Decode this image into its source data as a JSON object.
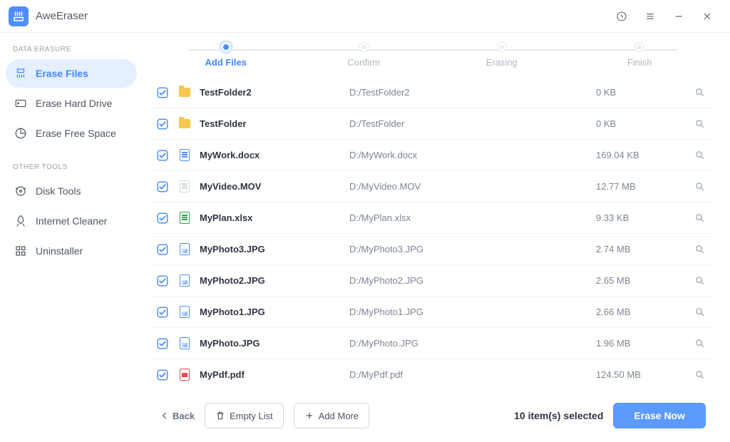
{
  "app": {
    "name": "AweEraser"
  },
  "sidebar": {
    "section1_label": "DATA ERASURE",
    "section2_label": "OTHER TOOLS",
    "items1": [
      {
        "label": "Erase Files",
        "active": true,
        "icon": "shredder"
      },
      {
        "label": "Erase Hard Drive",
        "active": false,
        "icon": "hdd"
      },
      {
        "label": "Erase Free Space",
        "active": false,
        "icon": "pie"
      }
    ],
    "items2": [
      {
        "label": "Disk Tools",
        "active": false,
        "icon": "disktool"
      },
      {
        "label": "Internet Cleaner",
        "active": false,
        "icon": "rocket"
      },
      {
        "label": "Uninstaller",
        "active": false,
        "icon": "apps"
      }
    ]
  },
  "steps": [
    {
      "label": "Add Files",
      "active": true
    },
    {
      "label": "Confirm",
      "active": false
    },
    {
      "label": "Erasing",
      "active": false
    },
    {
      "label": "Finish",
      "active": false
    }
  ],
  "files": [
    {
      "name": "TestFolder2",
      "path": "D:/TestFolder2",
      "size": "0 KB",
      "type": "folder"
    },
    {
      "name": "TestFolder",
      "path": "D:/TestFolder",
      "size": "0 KB",
      "type": "folder"
    },
    {
      "name": "MyWork.docx",
      "path": "D:/MyWork.docx",
      "size": "169.04 KB",
      "type": "doc"
    },
    {
      "name": "MyVideo.MOV",
      "path": "D:/MyVideo.MOV",
      "size": "12.77 MB",
      "type": "generic"
    },
    {
      "name": "MyPlan.xlsx",
      "path": "D:/MyPlan.xlsx",
      "size": "9.33 KB",
      "type": "xls"
    },
    {
      "name": "MyPhoto3.JPG",
      "path": "D:/MyPhoto3.JPG",
      "size": "2.74 MB",
      "type": "img"
    },
    {
      "name": "MyPhoto2.JPG",
      "path": "D:/MyPhoto2.JPG",
      "size": "2.65 MB",
      "type": "img"
    },
    {
      "name": "MyPhoto1.JPG",
      "path": "D:/MyPhoto1.JPG",
      "size": "2.66 MB",
      "type": "img"
    },
    {
      "name": "MyPhoto.JPG",
      "path": "D:/MyPhoto.JPG",
      "size": "1.96 MB",
      "type": "img"
    },
    {
      "name": "MyPdf.pdf",
      "path": "D:/MyPdf.pdf",
      "size": "124.50 MB",
      "type": "pdf"
    }
  ],
  "footer": {
    "back_label": "Back",
    "empty_label": "Empty List",
    "add_label": "Add More",
    "selected_text": "10 item(s) selected",
    "erase_label": "Erase Now"
  }
}
